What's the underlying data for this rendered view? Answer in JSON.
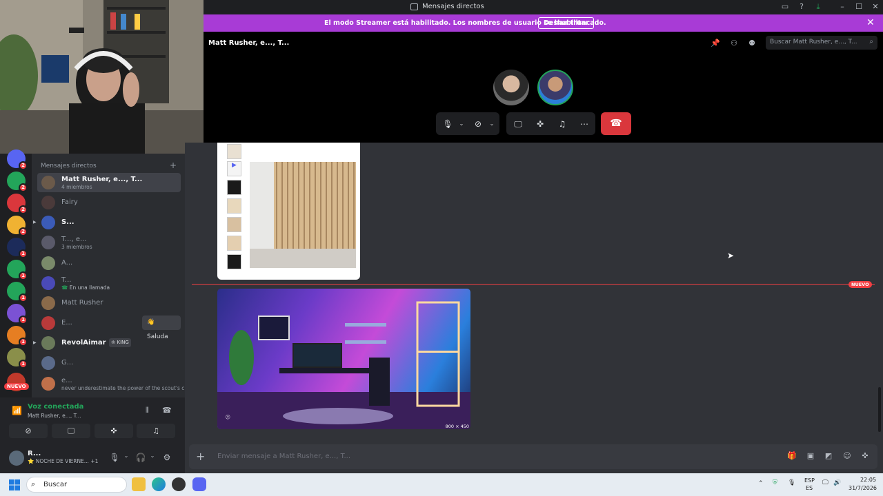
{
  "window": {
    "title": "Mensajes directos"
  },
  "banner": {
    "message": "El modo Streamer está habilitado. Los nombres de usuario se han truncado.",
    "button": "Deshabilitar"
  },
  "call": {
    "channel_name": "Matt Rusher, e..., T...",
    "search_placeholder": "Buscar Matt Rusher, e..., T..."
  },
  "dm_list": {
    "header": "Mensajes directos",
    "items": [
      {
        "name": "Matt Rusher, e..., T...",
        "sub": "4 miembros"
      },
      {
        "name": "Fairy",
        "sub": ""
      },
      {
        "name": "S...",
        "sub": ""
      },
      {
        "name": "T..., e...",
        "sub": "3 miembros"
      },
      {
        "name": "A...",
        "sub": ""
      },
      {
        "name": "T...",
        "sub": "En una llamada"
      },
      {
        "name": "Matt Rusher",
        "sub": ""
      },
      {
        "name": "E...",
        "sub": "",
        "action": "Saluda"
      },
      {
        "name": "RevolAimar",
        "sub": "",
        "tag": "KING"
      },
      {
        "name": "G...",
        "sub": ""
      },
      {
        "name": "e...",
        "sub": "never underestimate the power of the scout's c..."
      }
    ]
  },
  "rail": {
    "badges": [
      "2",
      "2",
      "2",
      "2",
      "1",
      "1",
      "1",
      "1",
      "1",
      "1"
    ],
    "new_label": "NUEVO"
  },
  "voice": {
    "status": "Voz conectada",
    "channel": "Matt Rusher, e..., T..."
  },
  "user": {
    "name": "R...",
    "status": "NOCHE DE VIERNE...",
    "extra": "+1"
  },
  "chat": {
    "new_marker": "NUEVO",
    "image_dims": "800 × 450"
  },
  "composer": {
    "placeholder": "Enviar mensaje a Matt Rusher, e..., T..."
  },
  "taskbar": {
    "search": "Buscar",
    "lang_top": "ESP",
    "lang_bottom": "ES",
    "time": "22:05",
    "date": "31/7/2026"
  }
}
